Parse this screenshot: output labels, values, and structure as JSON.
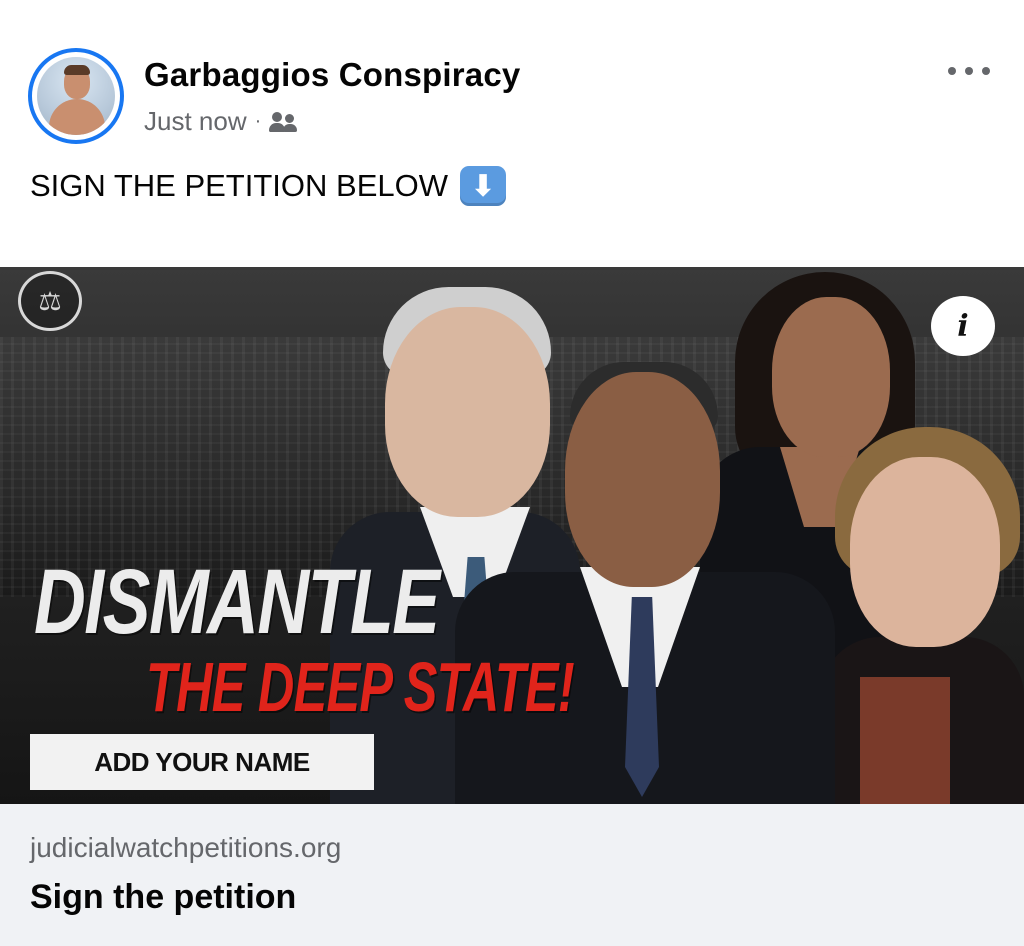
{
  "post": {
    "author": "Garbaggios Conspiracy",
    "timestamp": "Just now",
    "separator": "·",
    "audience_icon": "friends-icon",
    "more_icon": "more-options-icon",
    "text": "SIGN THE PETITION BELOW",
    "emoji": "⬇"
  },
  "ad": {
    "headline_line1": "DISMANTLE",
    "headline_line2": "THE DEEP STATE!",
    "cta": "ADD YOUR NAME",
    "info_label": "i",
    "seal_icon": "⚖",
    "colors": {
      "headline_red": "#e0241b",
      "accent_blue": "#1877f2"
    }
  },
  "link": {
    "domain": "judicialwatchpetitions.org",
    "title": "Sign the petition"
  }
}
